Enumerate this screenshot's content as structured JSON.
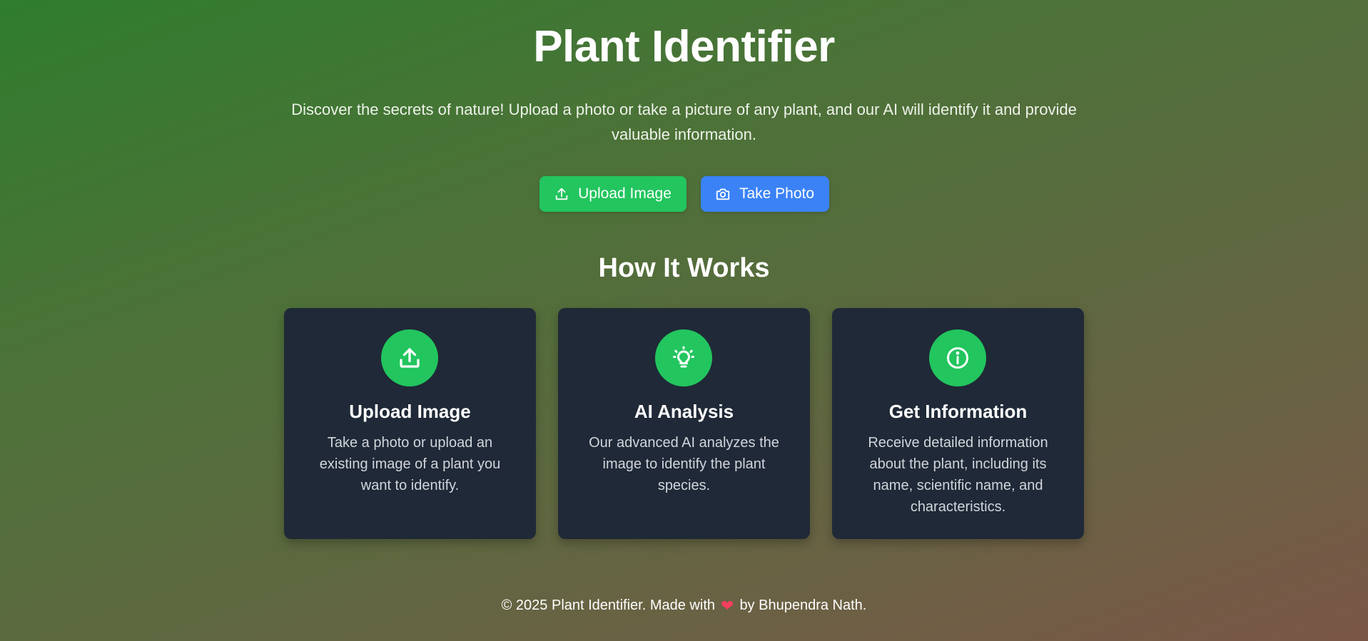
{
  "hero": {
    "title": "Plant Identifier",
    "subtitle": "Discover the secrets of nature! Upload a photo or take a picture of any plant, and our AI will identify it and provide valuable information."
  },
  "actions": {
    "upload_label": "Upload Image",
    "photo_label": "Take Photo",
    "upload_color": "#22c55e",
    "photo_color": "#3b82f6"
  },
  "how_it_works": {
    "title": "How It Works",
    "cards": [
      {
        "icon": "upload-icon",
        "title": "Upload Image",
        "text": "Take a photo or upload an existing image of a plant you want to identify."
      },
      {
        "icon": "lightbulb-icon",
        "title": "AI Analysis",
        "text": "Our advanced AI analyzes the image to identify the plant species."
      },
      {
        "icon": "info-icon",
        "title": "Get Information",
        "text": "Receive detailed information about the plant, including its name, scientific name, and characteristics."
      }
    ]
  },
  "footer": {
    "prefix": "© 2025 Plant Identifier. Made with",
    "heart": "❤",
    "suffix": "by Bhupendra Nath."
  },
  "colors": {
    "accent_green": "#22c55e",
    "accent_blue": "#3b82f6",
    "card_bg": "#1f2937",
    "heart": "#f43f5e"
  }
}
